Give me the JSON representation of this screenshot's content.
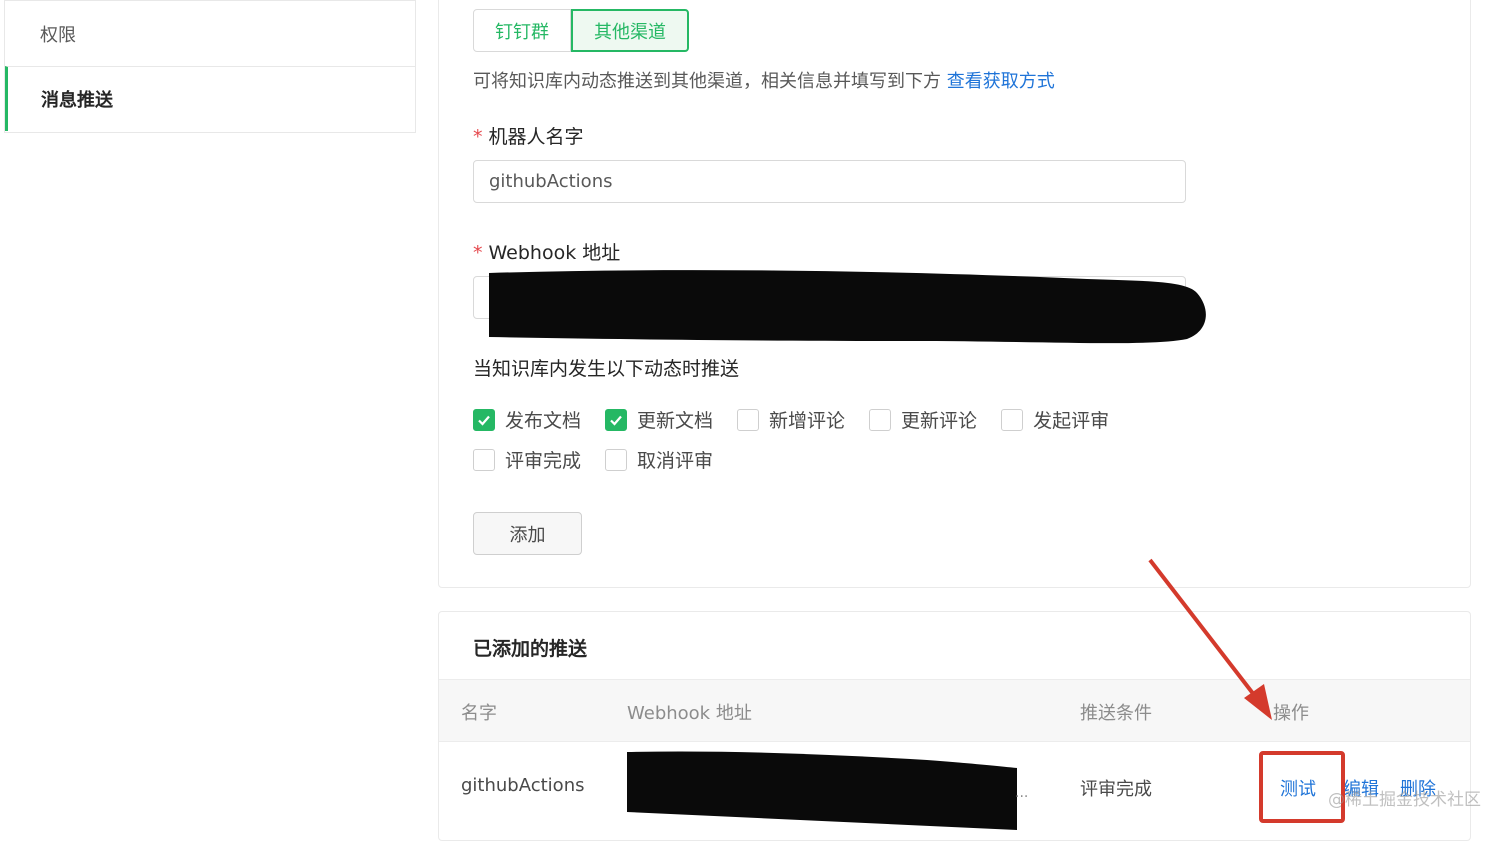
{
  "sidebar": {
    "items": [
      {
        "label": "权限"
      },
      {
        "label": "消息推送"
      }
    ]
  },
  "channel_tabs": [
    {
      "label": "钉钉群"
    },
    {
      "label": "其他渠道"
    }
  ],
  "description": {
    "text": "可将知识库内动态推送到其他渠道，相关信息并填写到下方",
    "link": "查看获取方式"
  },
  "form": {
    "required_mark": "*",
    "robot_name_label": "机器人名字",
    "robot_name_value": "githubActions",
    "webhook_label": "Webhook 地址",
    "events_label": "当知识库内发生以下动态时推送",
    "events": [
      {
        "label": "发布文档",
        "checked": true
      },
      {
        "label": "更新文档",
        "checked": true
      },
      {
        "label": "新增评论",
        "checked": false
      },
      {
        "label": "更新评论",
        "checked": false
      },
      {
        "label": "发起评审",
        "checked": false
      },
      {
        "label": "评审完成",
        "checked": false
      },
      {
        "label": "取消评审",
        "checked": false
      }
    ],
    "add_button": "添加"
  },
  "added_pushes": {
    "title": "已添加的推送",
    "columns": [
      "名字",
      "Webhook 地址",
      "推送条件",
      "操作"
    ],
    "rows": [
      {
        "name": "githubActions",
        "webhook_suffix": "...",
        "condition": "评审完成",
        "actions": [
          "测试",
          "编辑",
          "删除"
        ]
      }
    ]
  },
  "watermark": "@稀土掘金技术社区",
  "colors": {
    "accent_green": "#25b864",
    "link_blue": "#1f74d8",
    "annotation_red": "#d43a2c"
  }
}
